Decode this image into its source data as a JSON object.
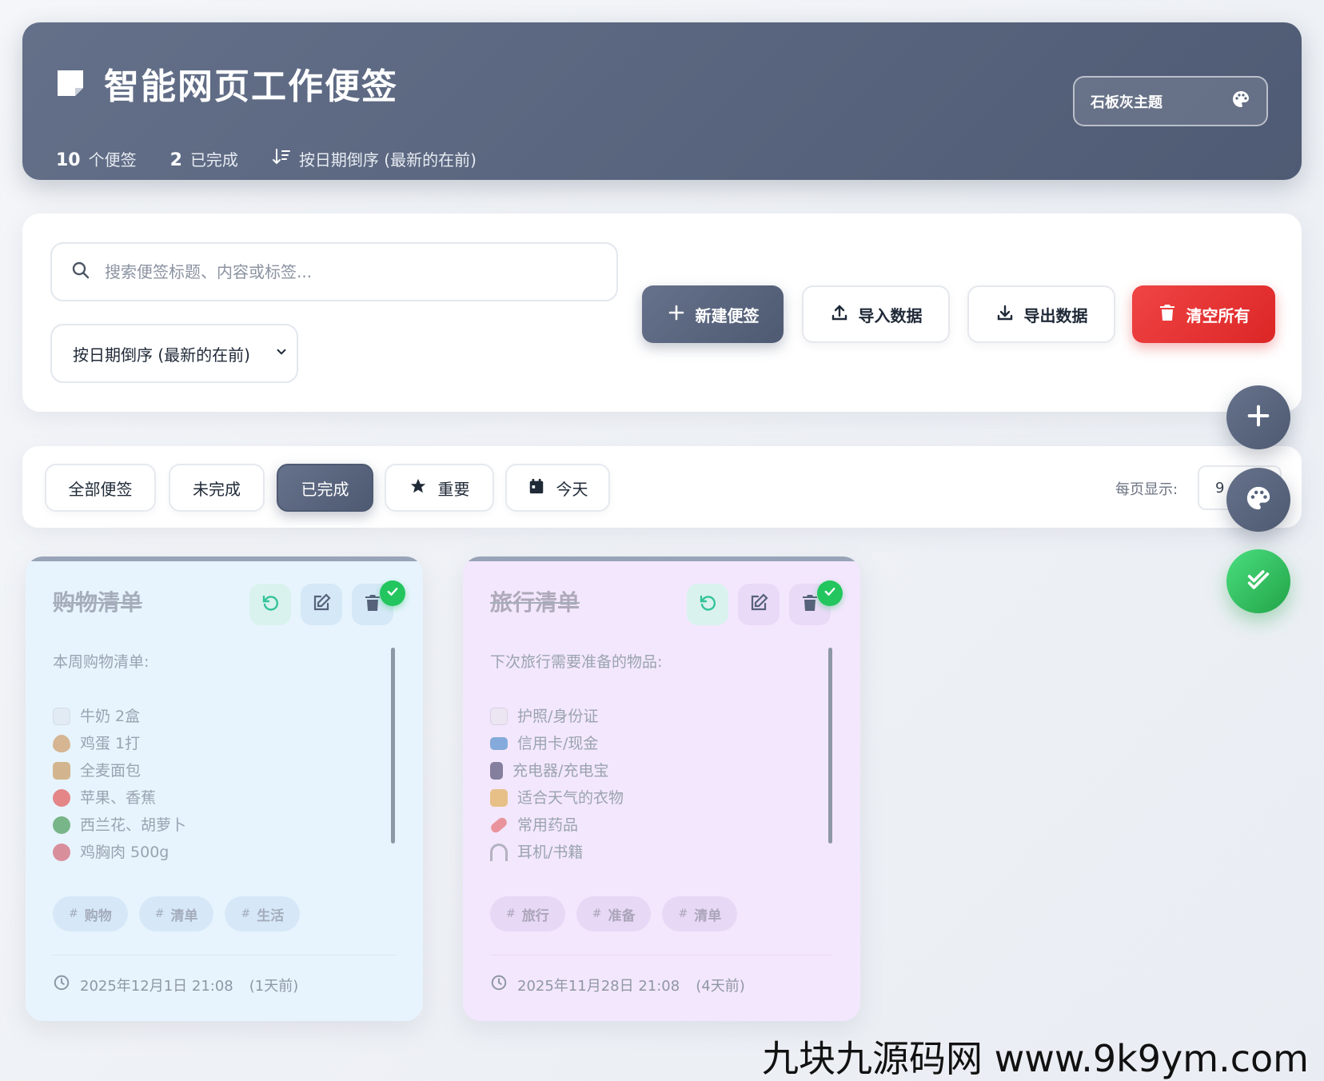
{
  "header": {
    "title": "智能网页工作便签",
    "stats": {
      "notes_count": "10",
      "notes_label": "个便签",
      "done_count": "2",
      "done_label": "已完成",
      "sort_label": "按日期倒序 (最新的在前)"
    },
    "theme_button": "石板灰主题"
  },
  "toolbar": {
    "search_placeholder": "搜索便签标题、内容或标签...",
    "sort_select": "按日期倒序 (最新的在前)",
    "new_note": "新建便签",
    "import": "导入数据",
    "export": "导出数据",
    "clear_all": "清空所有"
  },
  "filters": {
    "all": "全部便签",
    "undone": "未完成",
    "done": "已完成",
    "important": "重要",
    "today": "今天",
    "active": "已完成",
    "per_page_label": "每页显示:",
    "per_page_value": "9"
  },
  "notes": [
    {
      "title": "购物清单",
      "intro": "本周购物清单:",
      "items": [
        "牛奶 2盒",
        "鸡蛋 1打",
        "全麦面包",
        "苹果、香蕉",
        "西兰花、胡萝卜",
        "鸡胸肉 500g"
      ],
      "item_icons": [
        "milk-icon",
        "egg-icon",
        "box-icon",
        "apple-icon",
        "broccoli-icon",
        "meat-icon"
      ],
      "tags": [
        "购物",
        "清单",
        "生活"
      ],
      "date": "2025年12月1日 21:08",
      "ago": "(1天前)",
      "color": "#e7f4fd",
      "completed": true
    },
    {
      "title": "旅行清单",
      "intro": "下次旅行需要准备的物品:",
      "items": [
        "护照/身份证",
        "信用卡/现金",
        "充电器/充电宝",
        "适合天气的衣物",
        "常用药品",
        "耳机/书籍"
      ],
      "item_icons": [
        "document-icon",
        "credit-card-icon",
        "charger-icon",
        "clothes-icon",
        "pill-icon",
        "headphones-icon"
      ],
      "tags": [
        "旅行",
        "准备",
        "清单"
      ],
      "date": "2025年11月28日 21:08",
      "ago": "(4天前)",
      "color": "#f3e7fd",
      "completed": true
    }
  ],
  "watermark": "九块九源码网 www.9k9ym.com",
  "colors": {
    "primary": "#56627a",
    "danger": "#e53030",
    "success": "#22c55e"
  }
}
